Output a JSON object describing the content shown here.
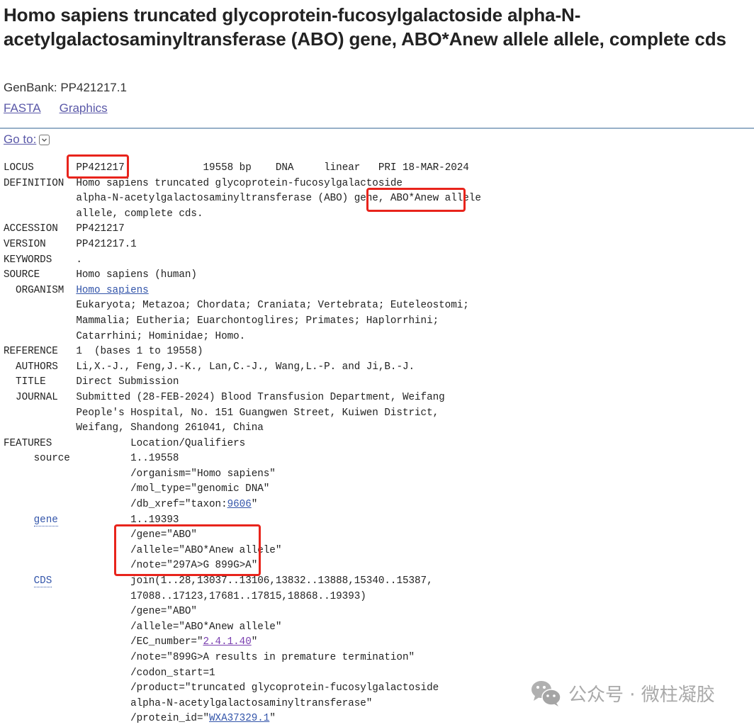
{
  "header": {
    "title": "Homo sapiens truncated glycoprotein-fucosylgalactoside alpha-N-acetylgalactosaminyltransferase (ABO) gene, ABO*Anew allele allele, complete cds",
    "genbank_label": "GenBank: PP421217.1",
    "links": [
      {
        "label": "FASTA"
      },
      {
        "label": "Graphics"
      }
    ],
    "goto_label": "Go to:",
    "goto_icon": "chevron-down-icon"
  },
  "record": {
    "locus": {
      "key": "LOCUS",
      "name": "PP421217",
      "rest": "             19558 bp    DNA     linear   PRI 18-MAR-2024"
    },
    "definition": {
      "key": "DEFINITION",
      "line1": "Homo sapiens truncated glycoprotein-fucosylgalactoside",
      "line2a": "alpha-N-acetylgalactosaminyltransferase (ABO) gene, ",
      "line2b": "ABO*Anew allele",
      "line3": "allele, complete cds."
    },
    "accession": {
      "key": "ACCESSION",
      "value": "PP421217"
    },
    "version": {
      "key": "VERSION",
      "value": "PP421217.1"
    },
    "keywords": {
      "key": "KEYWORDS",
      "value": "."
    },
    "source": {
      "key": "SOURCE",
      "value": "Homo sapiens (human)"
    },
    "organism": {
      "key": "  ORGANISM",
      "link": "Homo sapiens",
      "lineage": [
        "Eukaryota; Metazoa; Chordata; Craniata; Vertebrata; Euteleostomi;",
        "Mammalia; Eutheria; Euarchontoglires; Primates; Haplorrhini;",
        "Catarrhini; Hominidae; Homo."
      ]
    },
    "reference": {
      "key": "REFERENCE",
      "value": "1  (bases 1 to 19558)"
    },
    "authors": {
      "key": "  AUTHORS",
      "value": "Li,X.-J., Feng,J.-K., Lan,C.-J., Wang,L.-P. and Ji,B.-J."
    },
    "ref_title": {
      "key": "  TITLE",
      "value": "Direct Submission"
    },
    "journal": {
      "key": "  JOURNAL",
      "lines": [
        "Submitted (28-FEB-2024) Blood Transfusion Department, Weifang",
        "People's Hospital, No. 151 Guangwen Street, Kuiwen District,",
        "Weifang, Shandong 261041, China"
      ]
    },
    "features": {
      "key": "FEATURES",
      "header": "Location/Qualifiers",
      "source": {
        "key": "source",
        "location": "1..19558",
        "organism": "/organism=\"Homo sapiens\"",
        "mol_type": "/mol_type=\"genomic DNA\"",
        "db_xref_prefix": "/db_xref=\"taxon:",
        "db_xref_link": "9606",
        "db_xref_suffix": "\""
      },
      "gene": {
        "key": "gene",
        "location": "1..19393",
        "gene": "/gene=\"ABO\"",
        "allele": "/allele=\"ABO*Anew allele\"",
        "note": "/note=\"297A>G 899G>A\""
      },
      "cds": {
        "key": "CDS",
        "location1": "join(1..28,13037..13106,13832..13888,15340..15387,",
        "location2": "17088..17123,17681..17815,18868..19393)",
        "gene": "/gene=\"ABO\"",
        "allele": "/allele=\"ABO*Anew allele\"",
        "ec_prefix": "/EC_number=\"",
        "ec_link": "2.4.1.40",
        "ec_suffix": "\"",
        "note": "/note=\"899G>A results in premature termination\"",
        "codon_start": "/codon_start=1",
        "product1": "/product=\"truncated glycoprotein-fucosylgalactoside",
        "product2": "alpha-N-acetylgalactosaminyltransferase\"",
        "protein_prefix": "/protein_id=\"",
        "protein_link": "WXA37329.1",
        "protein_suffix": "\""
      }
    }
  },
  "colors": {
    "highlight": "#e8241c",
    "link": "#3355aa",
    "visited_link": "#7a3fb0",
    "rule": "#97b0c8"
  },
  "watermark": {
    "icon": "wechat-icon",
    "text": "公众号 · 微柱凝胶"
  }
}
